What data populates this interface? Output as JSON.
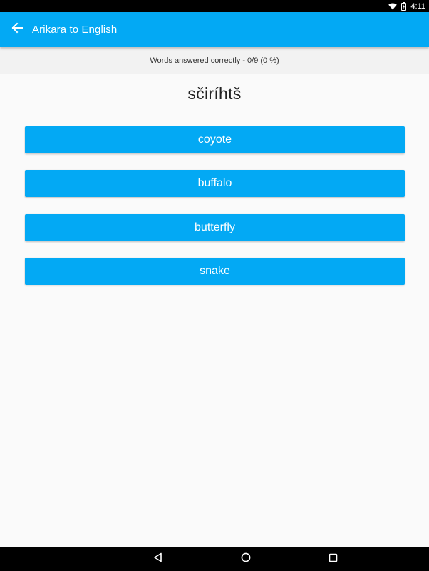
{
  "status_bar": {
    "time": "4:11",
    "icons": [
      "wifi-icon",
      "battery-icon"
    ]
  },
  "app_bar": {
    "title": "Arikara to English",
    "back_icon": "arrow-left-icon"
  },
  "score": {
    "text": "Words answered correctly - 0/9 (0 %)"
  },
  "quiz": {
    "word": "sčiríhtš",
    "answers": [
      {
        "label": "coyote"
      },
      {
        "label": "buffalo"
      },
      {
        "label": "butterfly"
      },
      {
        "label": "snake"
      }
    ]
  },
  "nav_bar": {
    "icons": [
      "back-triangle-icon",
      "home-circle-icon",
      "recents-square-icon"
    ]
  },
  "colors": {
    "accent": "#03a9f4",
    "background": "#fafafa",
    "score_strip": "#f2f2f2"
  }
}
